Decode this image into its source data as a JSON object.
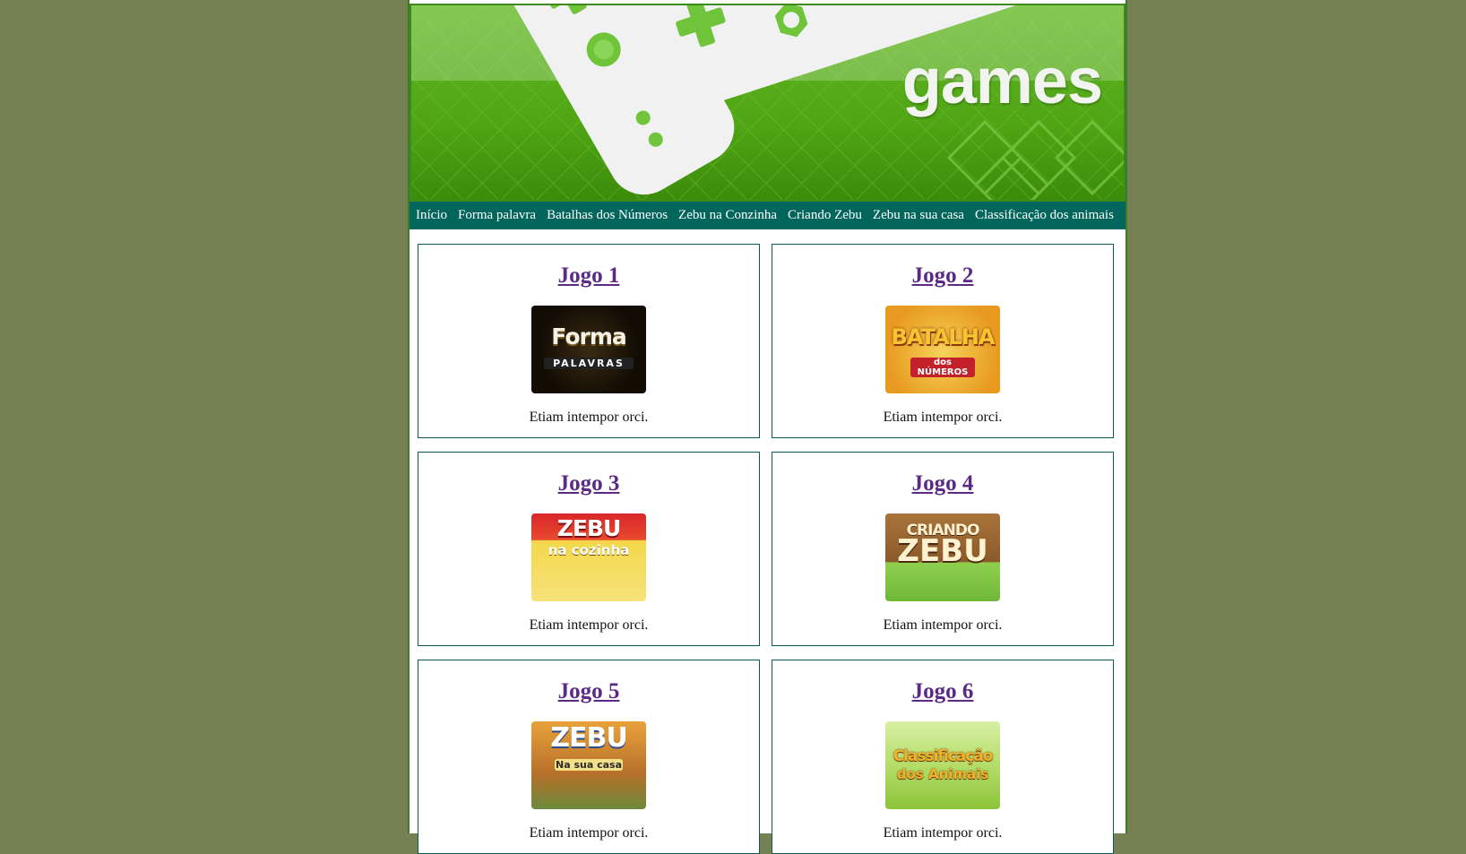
{
  "banner": {
    "title": "games"
  },
  "nav": {
    "items": [
      "Início",
      "Forma palavra",
      "Batalhas dos Números",
      "Zebu na Conzinha",
      "Criando Zebu",
      "Zebu na sua casa",
      "Classificação dos animais"
    ]
  },
  "games": [
    {
      "title": "Jogo 1",
      "description": "Etiam intempor orci.",
      "thumb_text": "Forma",
      "thumb_sub": "PALAVRAS"
    },
    {
      "title": "Jogo 2",
      "description": "Etiam intempor orci.",
      "thumb_text": "BATALHA",
      "thumb_sub": "dos NÚMEROS"
    },
    {
      "title": "Jogo 3",
      "description": "Etiam intempor orci.",
      "thumb_text": "ZEBU",
      "thumb_sub": "na cozinha"
    },
    {
      "title": "Jogo 4",
      "description": "Etiam intempor orci.",
      "thumb_text": "CRIANDO",
      "thumb_sub": "ZEBU"
    },
    {
      "title": "Jogo 5",
      "description": "Etiam intempor orci.",
      "thumb_text": "ZEBU",
      "thumb_sub": "Na sua casa"
    },
    {
      "title": "Jogo 6",
      "description": "Etiam intempor orci.",
      "thumb_text": "Classificação",
      "thumb_sub": "dos Animais"
    }
  ],
  "colors": {
    "background": "#758053",
    "nav": "#03665c",
    "link": "#5b2a86",
    "card_border": "#0b5a52"
  }
}
